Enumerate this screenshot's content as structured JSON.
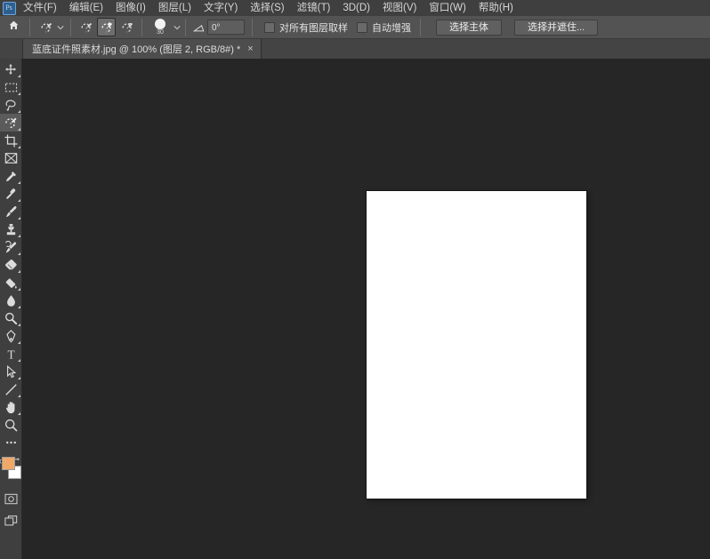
{
  "app": {
    "logo_glyph": "Ps",
    "background_color": "#262626",
    "chrome_color": "#3f3f3f",
    "options_bar_color": "#535353"
  },
  "menubar": {
    "items": [
      {
        "label": "文件(F)"
      },
      {
        "label": "编辑(E)"
      },
      {
        "label": "图像(I)"
      },
      {
        "label": "图层(L)"
      },
      {
        "label": "文字(Y)"
      },
      {
        "label": "选择(S)"
      },
      {
        "label": "滤镜(T)"
      },
      {
        "label": "3D(D)"
      },
      {
        "label": "视图(V)"
      },
      {
        "label": "窗口(W)"
      },
      {
        "label": "帮助(H)"
      }
    ]
  },
  "optionsbar": {
    "home_icon": "home-icon",
    "tool_preset_icon": "quick-selection-tool-icon",
    "tool_preset_chevron": "chevron-down-icon",
    "selection_modes": [
      {
        "name": "new-selection",
        "icon": "quick-selection-new-icon",
        "active": false
      },
      {
        "name": "add-to-selection",
        "icon": "quick-selection-add-icon",
        "active": true
      },
      {
        "name": "subtract-from-selection",
        "icon": "quick-selection-subtract-icon",
        "active": false
      }
    ],
    "brush": {
      "preview_icon": "brush-tip-circle-icon",
      "size": "30",
      "chevron": "chevron-down-icon"
    },
    "angle": {
      "icon": "angle-icon",
      "value": "0°"
    },
    "checkboxes": [
      {
        "label": "对所有图层取样",
        "checked": false
      },
      {
        "label": "自动增强",
        "checked": false
      }
    ],
    "buttons": [
      {
        "label": "选择主体"
      },
      {
        "label": "选择并遮住..."
      }
    ]
  },
  "tabbar": {
    "document_tab": {
      "title": "蓝底证件照素材.jpg @ 100% (图层 2, RGB/8#) *",
      "close_glyph": "×"
    }
  },
  "toolbar": {
    "tools": [
      {
        "name": "move-tool",
        "icon": "move-tool-icon",
        "has_submenu": true,
        "active": false
      },
      {
        "name": "marquee-tool",
        "icon": "rectangular-marquee-icon",
        "has_submenu": true,
        "active": false
      },
      {
        "name": "lasso-tool",
        "icon": "lasso-tool-icon",
        "has_submenu": true,
        "active": false
      },
      {
        "name": "quick-selection-tool",
        "icon": "quick-selection-tool-icon",
        "has_submenu": true,
        "active": true
      },
      {
        "name": "crop-tool",
        "icon": "crop-tool-icon",
        "has_submenu": true,
        "active": false
      },
      {
        "name": "frame-tool",
        "icon": "frame-tool-icon",
        "has_submenu": false,
        "active": false
      },
      {
        "name": "eyedropper-tool",
        "icon": "eyedropper-icon",
        "has_submenu": true,
        "active": false
      },
      {
        "name": "healing-brush-tool",
        "icon": "healing-brush-icon",
        "has_submenu": true,
        "active": false
      },
      {
        "name": "brush-tool",
        "icon": "brush-icon",
        "has_submenu": true,
        "active": false
      },
      {
        "name": "clone-stamp-tool",
        "icon": "clone-stamp-icon",
        "has_submenu": true,
        "active": false
      },
      {
        "name": "history-brush-tool",
        "icon": "history-brush-icon",
        "has_submenu": true,
        "active": false
      },
      {
        "name": "eraser-tool",
        "icon": "eraser-icon",
        "has_submenu": true,
        "active": false
      },
      {
        "name": "gradient-tool",
        "icon": "paint-bucket-icon",
        "has_submenu": true,
        "active": false
      },
      {
        "name": "blur-tool",
        "icon": "blur-droplet-icon",
        "has_submenu": true,
        "active": false
      },
      {
        "name": "dodge-tool",
        "icon": "dodge-icon",
        "has_submenu": true,
        "active": false
      },
      {
        "name": "pen-tool",
        "icon": "pen-tool-icon",
        "has_submenu": true,
        "active": false
      },
      {
        "name": "type-tool",
        "icon": "type-tool-icon",
        "has_submenu": true,
        "active": false
      },
      {
        "name": "path-selection-tool",
        "icon": "path-selection-arrow-icon",
        "has_submenu": true,
        "active": false
      },
      {
        "name": "line-shape-tool",
        "icon": "line-tool-icon",
        "has_submenu": true,
        "active": false
      },
      {
        "name": "hand-tool",
        "icon": "hand-tool-icon",
        "has_submenu": true,
        "active": false
      },
      {
        "name": "zoom-tool",
        "icon": "zoom-magnifier-icon",
        "has_submenu": false,
        "active": false
      },
      {
        "name": "edit-toolbar",
        "icon": "ellipsis-icon",
        "has_submenu": false,
        "active": false
      }
    ],
    "colors": {
      "foreground": "#f0a868",
      "background": "#ffffff",
      "reset_icon": "reset-colors-icon",
      "swap_icon": "swap-colors-icon"
    },
    "bottom_tools": [
      {
        "name": "quick-mask-toggle",
        "icon": "quick-mask-icon"
      },
      {
        "name": "screen-mode-toggle",
        "icon": "screen-mode-icon"
      }
    ]
  },
  "canvas": {
    "document_color": "#ffffff",
    "zoom": "100%"
  }
}
